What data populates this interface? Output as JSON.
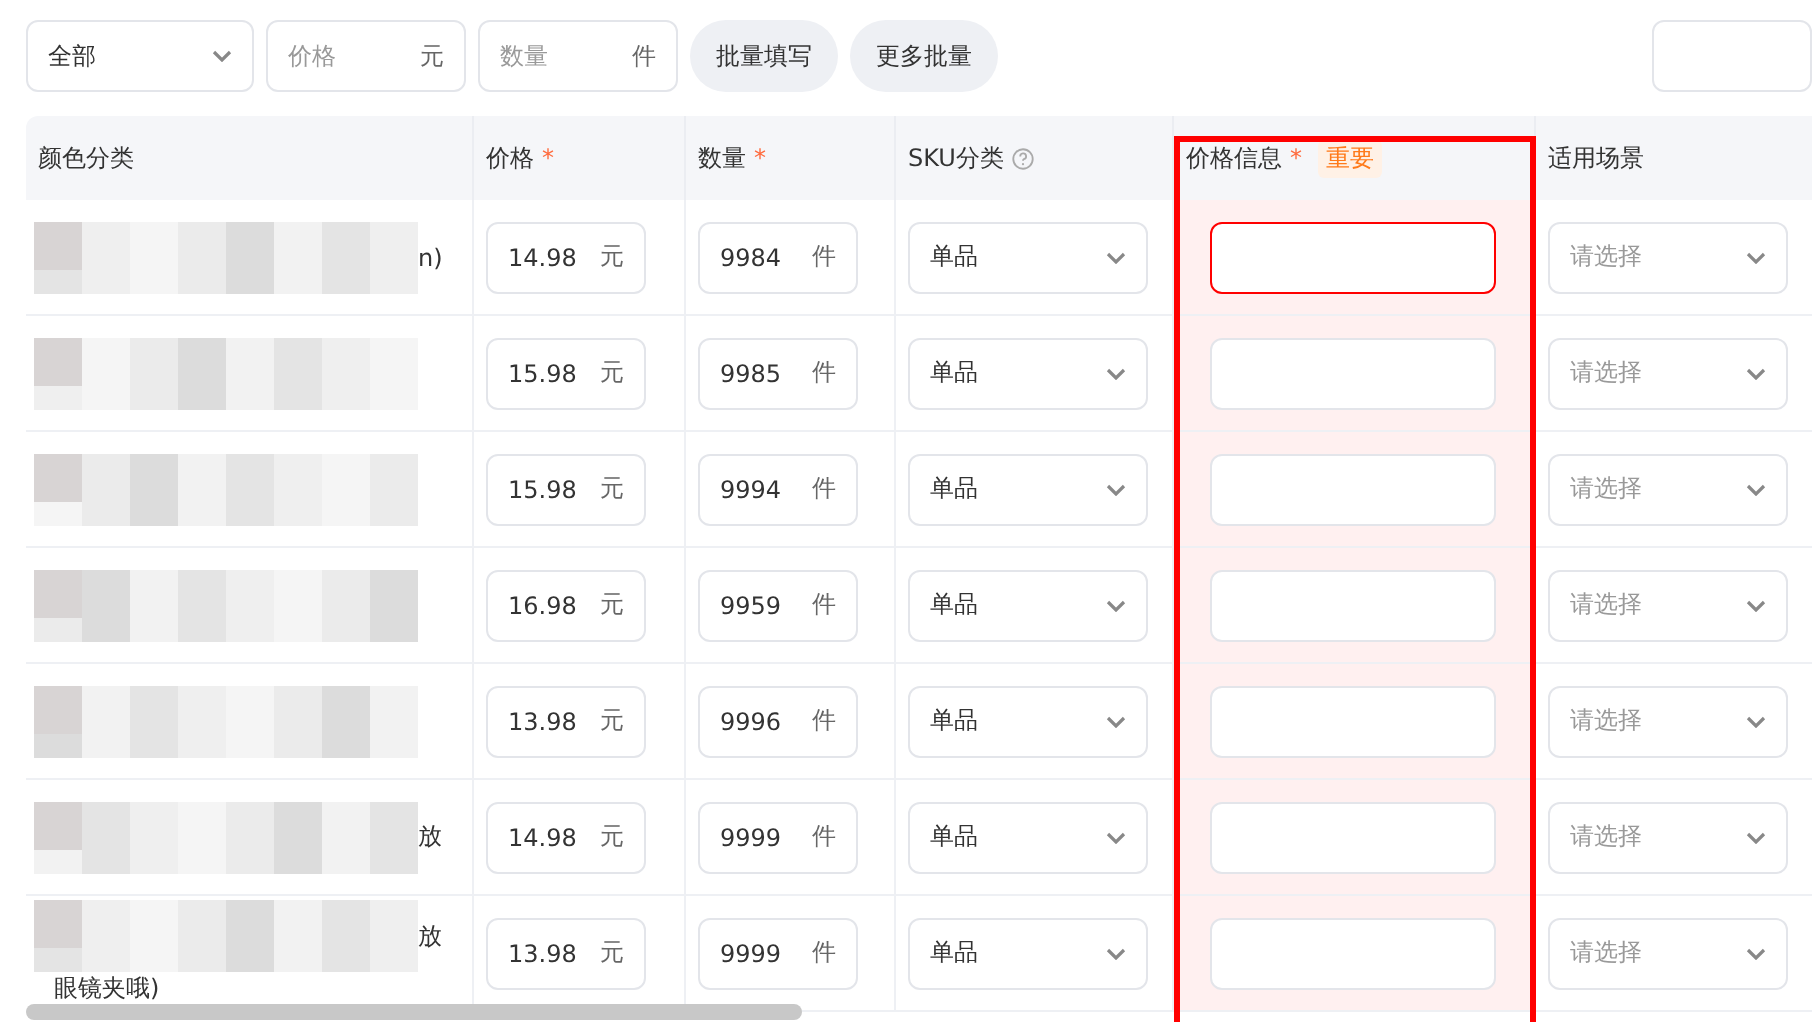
{
  "toolbar": {
    "scope_select": {
      "value": "全部"
    },
    "price_input": {
      "placeholder": "价格",
      "unit": "元"
    },
    "qty_input": {
      "placeholder": "数量",
      "unit": "件"
    },
    "buttons": [
      "批量填写",
      "更多批量"
    ]
  },
  "table": {
    "columns": [
      {
        "label": "颜色分类",
        "help": false,
        "highlighted": false
      },
      {
        "label": "价格",
        "required_mark": "*",
        "help": false,
        "highlighted": false
      },
      {
        "label": "数量",
        "required_mark": "*",
        "help": false,
        "highlighted": false
      },
      {
        "label": "SKU分类",
        "help": true,
        "highlighted": false
      },
      {
        "label": "价格信息",
        "required_mark": "*",
        "help": false,
        "highlighted": true,
        "badge": "重要"
      },
      {
        "label": "适用场景",
        "help": false,
        "highlighted": false
      }
    ],
    "rows": [
      {
        "color_tail": "n)",
        "price": "14.98",
        "price_unit": "元",
        "qty": "9984",
        "qty_unit": "件",
        "sku": "单品",
        "price_info_invalid": true,
        "scene_placeholder": "请选择"
      },
      {
        "price": "15.98",
        "price_unit": "元",
        "qty": "9985",
        "qty_unit": "件",
        "sku": "单品",
        "price_info_invalid": false,
        "scene_placeholder": "请选择"
      },
      {
        "price": "15.98",
        "price_unit": "元",
        "qty": "9994",
        "qty_unit": "件",
        "sku": "单品",
        "price_info_invalid": false,
        "scene_placeholder": "请选择"
      },
      {
        "price": "16.98",
        "price_unit": "元",
        "qty": "9959",
        "qty_unit": "件",
        "sku": "单品",
        "price_info_invalid": false,
        "scene_placeholder": "请选择"
      },
      {
        "price": "13.98",
        "price_unit": "元",
        "qty": "9996",
        "qty_unit": "件",
        "sku": "单品",
        "price_info_invalid": false,
        "scene_placeholder": "请选择"
      },
      {
        "color_tail": "放",
        "price": "14.98",
        "price_unit": "元",
        "qty": "9999",
        "qty_unit": "件",
        "sku": "单品",
        "price_info_invalid": false,
        "scene_placeholder": "请选择"
      },
      {
        "color_tail": "放",
        "color_next_line": "眼镜夹哦)",
        "price": "13.98",
        "price_unit": "元",
        "qty": "9999",
        "qty_unit": "件",
        "sku": "单品",
        "price_info_invalid": false,
        "scene_placeholder": "请选择"
      }
    ]
  }
}
